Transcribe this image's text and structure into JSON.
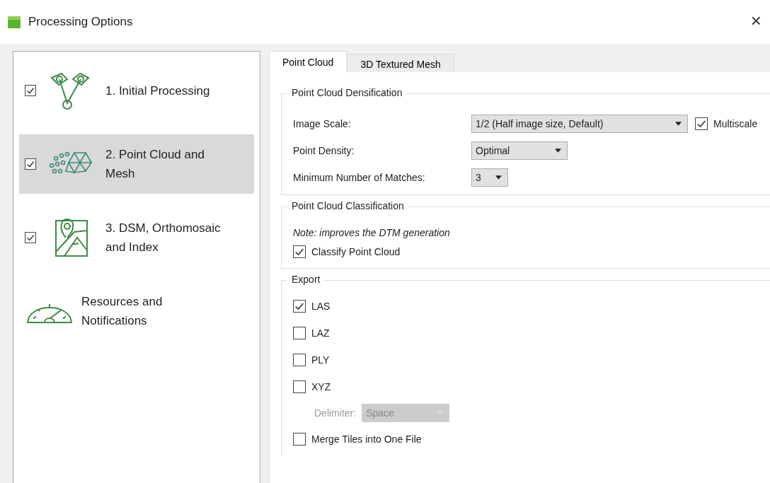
{
  "window": {
    "title": "Processing Options",
    "close": "×"
  },
  "sidebar": {
    "items": [
      {
        "label": "1. Initial Processing",
        "checked": true,
        "selected": false
      },
      {
        "label": "2. Point Cloud and Mesh",
        "checked": true,
        "selected": true
      },
      {
        "label": "3. DSM, Orthomosaic and Index",
        "checked": true,
        "selected": false
      },
      {
        "label": "Resources and Notifications",
        "selected": false
      }
    ]
  },
  "tabs": [
    {
      "label": "Point Cloud",
      "selected": true
    },
    {
      "label": "3D Textured Mesh",
      "selected": false
    }
  ],
  "densification": {
    "title": "Point Cloud Densification",
    "image_scale": {
      "label": "Image Scale:",
      "value": "1/2 (Half image size, Default)"
    },
    "multiscale": {
      "label": "Multiscale",
      "checked": true
    },
    "point_density": {
      "label": "Point Density:",
      "value": "Optimal"
    },
    "min_matches": {
      "label": "Minimum Number of Matches:",
      "value": "3"
    }
  },
  "classification": {
    "title": "Point Cloud Classification",
    "note": "Note: improves the DTM generation",
    "classify": {
      "label": "Classify Point Cloud",
      "checked": true
    }
  },
  "export": {
    "title": "Export",
    "formats": [
      {
        "label": "LAS",
        "checked": true
      },
      {
        "label": "LAZ",
        "checked": false
      },
      {
        "label": "PLY",
        "checked": false
      },
      {
        "label": "XYZ",
        "checked": false
      }
    ],
    "delimiter": {
      "label": "Delimiter:",
      "value": "Space",
      "disabled": true
    },
    "merge": {
      "label": "Merge Tiles into One File",
      "checked": false
    }
  }
}
